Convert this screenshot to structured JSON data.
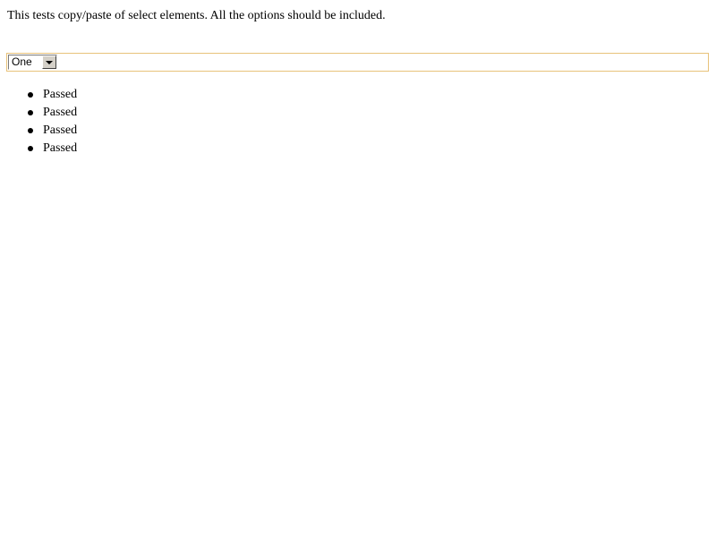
{
  "description": "This tests copy/paste of select elements. All the options should be included.",
  "select": {
    "selected_value": "One"
  },
  "results": {
    "items": [
      {
        "label": "Passed"
      },
      {
        "label": "Passed"
      },
      {
        "label": "Passed"
      },
      {
        "label": "Passed"
      }
    ]
  },
  "colors": {
    "editable_border": "#e8c27a",
    "button_face": "#d4d0c8"
  }
}
